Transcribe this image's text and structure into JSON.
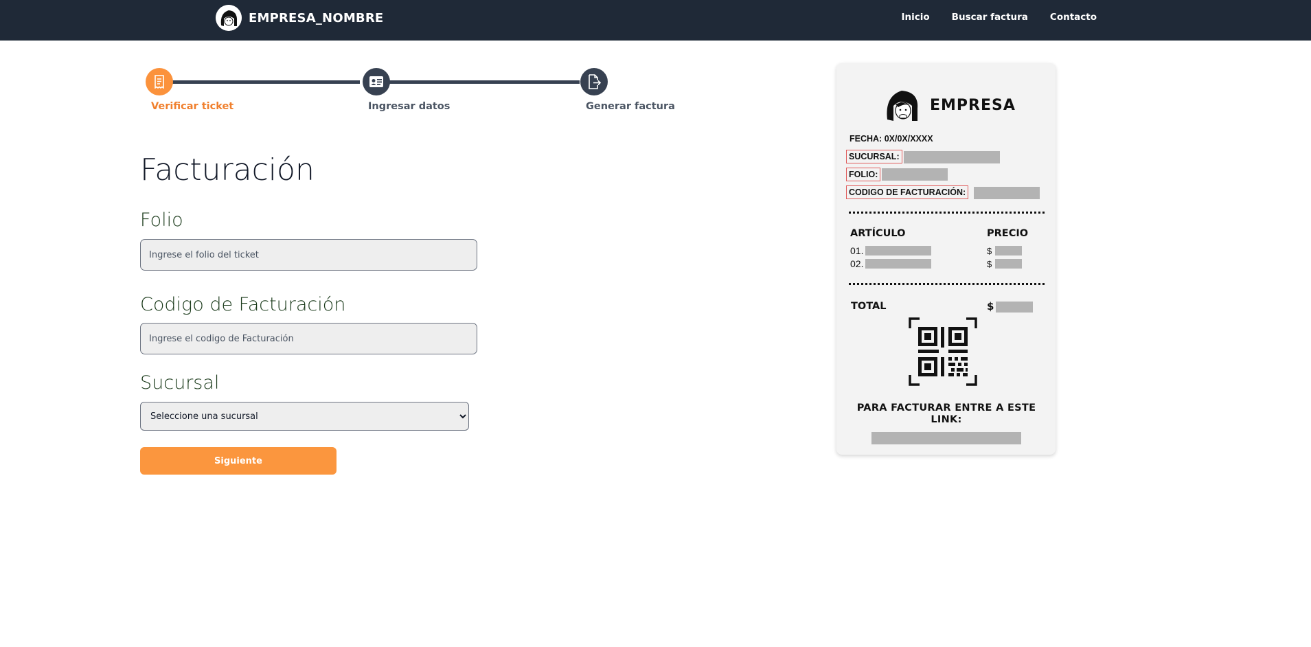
{
  "navbar": {
    "brand_name": "EMPRESA_NOMBRE",
    "links": [
      "Inicio",
      "Buscar factura",
      "Contacto"
    ]
  },
  "stepper": {
    "steps": [
      {
        "label": "Verificar ticket",
        "icon": "receipt-icon",
        "state": "active"
      },
      {
        "label": "Ingresar datos",
        "icon": "id-card-icon",
        "state": "pending"
      },
      {
        "label": "Generar factura",
        "icon": "file-export-icon",
        "state": "pending"
      }
    ]
  },
  "form": {
    "title": "Facturación",
    "folio": {
      "label": "Folio",
      "value": "",
      "placeholder": "Ingrese el folio del ticket"
    },
    "codigo": {
      "label": "Codigo de Facturación",
      "value": "",
      "placeholder": "Ingrese el codigo de Facturación"
    },
    "sucursal": {
      "label": "Sucursal",
      "selected": "Seleccione una sucursal"
    },
    "submit_label": "Siguiente"
  },
  "ticket": {
    "brand": "EMPRESA",
    "fecha": "FECHA: 0X/0X/XXXX",
    "sucursal_label": "SUCURSAL:",
    "folio_label": "FOLIO:",
    "codigo_label": "CODIGO DE FACTURACIÓN:",
    "articulo_header": "ARTÍCULO",
    "precio_header": "PRECIO",
    "items": [
      "01.",
      "02."
    ],
    "currency": "$",
    "total_label": "TOTAL",
    "footer": "PARA FACTURAR ENTRE A ESTE LINK:"
  },
  "colors": {
    "navbar_bg": "#1f2937",
    "accent": "#fb923c",
    "step_inactive": "#374151",
    "highlight_border": "#e05a5a",
    "redaction": "#b3b3b3"
  }
}
